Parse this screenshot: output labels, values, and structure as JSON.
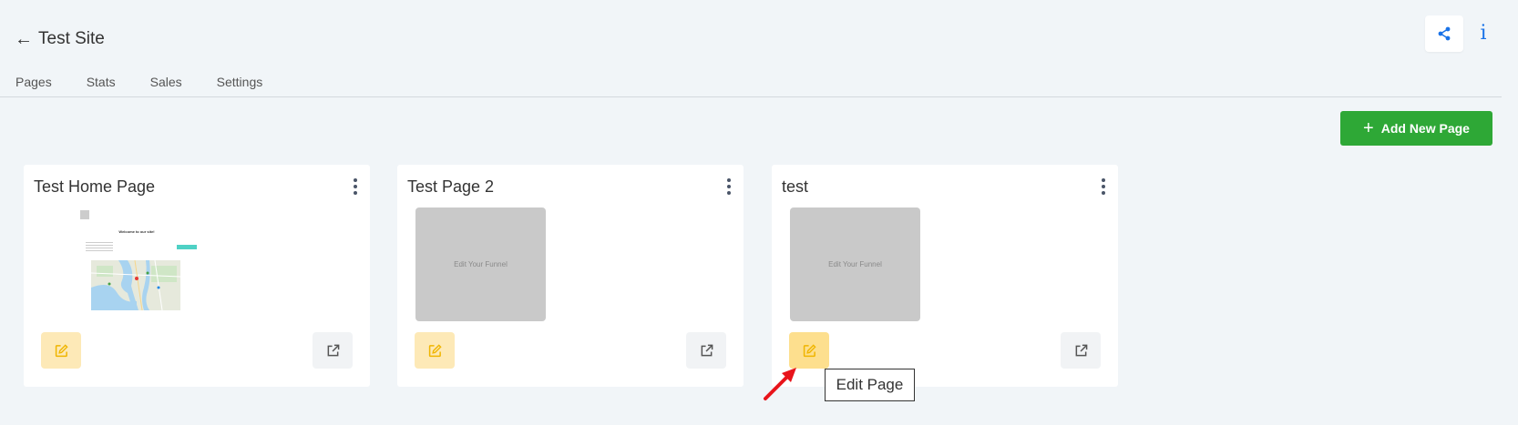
{
  "header": {
    "back_icon": "arrow-left-icon",
    "title": "Test Site",
    "share_icon": "share-icon",
    "info_icon": "info-icon",
    "info_glyph": "i"
  },
  "tabs": [
    {
      "label": "Pages"
    },
    {
      "label": "Stats"
    },
    {
      "label": "Sales"
    },
    {
      "label": "Settings"
    }
  ],
  "add_button": {
    "label": "Add New Page",
    "icon": "plus-icon"
  },
  "cards": [
    {
      "title": "Test Home Page",
      "preview": {
        "type": "screenshot",
        "heading": "Welcome to our site!"
      }
    },
    {
      "title": "Test Page 2",
      "preview": {
        "type": "placeholder",
        "text": "Edit Your Funnel"
      }
    },
    {
      "title": "test",
      "preview": {
        "type": "placeholder",
        "text": "Edit Your Funnel"
      }
    }
  ],
  "tooltip": {
    "text": "Edit Page"
  },
  "colors": {
    "accent_green": "#2ea836",
    "edit_yellow": "#fde9b7",
    "edit_icon": "#f0b500",
    "info_blue": "#1a73e8",
    "annotation_arrow": "#e8141b"
  }
}
